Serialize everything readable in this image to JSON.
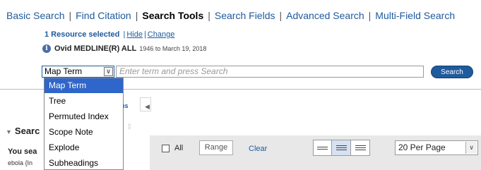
{
  "nav": {
    "tabs": [
      {
        "label": "Basic Search"
      },
      {
        "label": "Find Citation"
      },
      {
        "label": "Search Tools"
      },
      {
        "label": "Search Fields"
      },
      {
        "label": "Advanced Search"
      },
      {
        "label": "Multi-Field Search"
      }
    ],
    "separator": "|"
  },
  "resource": {
    "count_text": "1 Resource selected",
    "hide_label": "Hide",
    "change_label": "Change",
    "separator": "|",
    "info_icon": "i",
    "database": "Ovid MEDLINE(R) ALL",
    "date_range": "1946 to March 19, 2018"
  },
  "search": {
    "mode_selected": "Map Term",
    "input_placeholder": "Enter term and press Search",
    "button_label": "Search"
  },
  "dropdown": {
    "options": [
      {
        "label": "Map Term"
      },
      {
        "label": "Tree"
      },
      {
        "label": "Permuted Index"
      },
      {
        "label": "Scope Note"
      },
      {
        "label": "Explode"
      },
      {
        "label": "Subheadings"
      }
    ]
  },
  "left_panel": {
    "tab_fragment": "ıs",
    "collapse_icon": "◀",
    "heading": "Searc",
    "heading_icon": "▼",
    "grip_icon": "⁞⁞",
    "you_searched": "You sea",
    "query_fragment": "ebola {In"
  },
  "toolbar": {
    "select_all_label": "All",
    "range_label": "Range",
    "clear_label": "Clear",
    "per_page": "20 Per Page",
    "chevron": "∨"
  },
  "colors": {
    "link": "#1f5a9c",
    "button_bg": "#1f5a9c",
    "dropdown_selected": "#2f66c9",
    "toolbar_bg": "#e8e8e8"
  }
}
